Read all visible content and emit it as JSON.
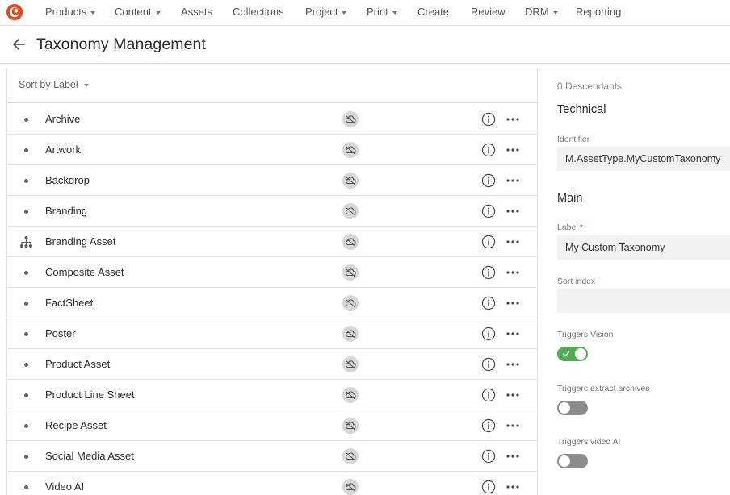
{
  "nav": {
    "items": [
      {
        "label": "Products",
        "dropdown": true
      },
      {
        "label": "Content",
        "dropdown": true
      },
      {
        "label": "Assets",
        "dropdown": false
      },
      {
        "label": "Collections",
        "dropdown": false
      },
      {
        "label": "Project",
        "dropdown": true
      },
      {
        "label": "Print",
        "dropdown": true
      },
      {
        "label": "Create",
        "dropdown": false
      },
      {
        "label": "Review",
        "dropdown": false
      },
      {
        "label": "DRM",
        "dropdown": true
      },
      {
        "label": "Reporting",
        "dropdown": false
      }
    ]
  },
  "header": {
    "title": "Taxonomy Management"
  },
  "list": {
    "sort_label": "Sort by Label",
    "rows": [
      {
        "label": "Archive",
        "icon": "bullet-icon"
      },
      {
        "label": "Artwork",
        "icon": "bullet-icon"
      },
      {
        "label": "Backdrop",
        "icon": "bullet-icon"
      },
      {
        "label": "Branding",
        "icon": "bullet-icon"
      },
      {
        "label": "Branding Asset",
        "icon": "hierarchy-icon"
      },
      {
        "label": "Composite Asset",
        "icon": "bullet-icon"
      },
      {
        "label": "FactSheet",
        "icon": "bullet-icon"
      },
      {
        "label": "Poster",
        "icon": "bullet-icon"
      },
      {
        "label": "Product Asset",
        "icon": "bullet-icon"
      },
      {
        "label": "Product Line Sheet",
        "icon": "bullet-icon"
      },
      {
        "label": "Recipe Asset",
        "icon": "bullet-icon"
      },
      {
        "label": "Social Media Asset",
        "icon": "bullet-icon"
      },
      {
        "label": "Video AI",
        "icon": "bullet-icon"
      }
    ]
  },
  "details": {
    "descendants": "0 Descendants",
    "technical_title": "Technical",
    "identifier_label": "Identifier",
    "identifier_value": "M.AssetType.MyCustomTaxonomy",
    "main_title": "Main",
    "label_label": "Label",
    "label_required": "*",
    "label_value": "My Custom Taxonomy",
    "sort_index_label": "Sort index",
    "sort_index_value": "",
    "triggers_vision_label": "Triggers Vision",
    "triggers_vision_on": true,
    "triggers_extract_label": "Triggers extract archives",
    "triggers_extract_on": false,
    "triggers_video_label": "Triggers video AI",
    "triggers_video_on": false
  },
  "colors": {
    "accent_red": "#e8431a",
    "toggle_on": "#4caf50",
    "toggle_off": "#8c8c8c"
  }
}
